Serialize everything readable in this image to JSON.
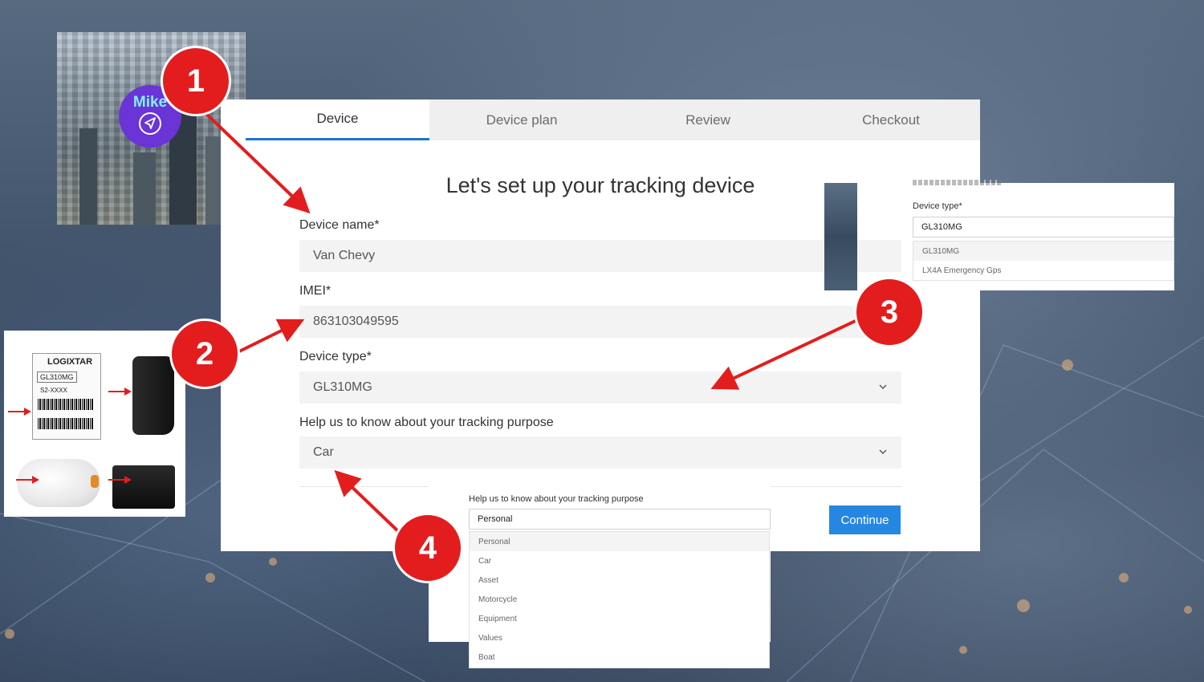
{
  "tabs": [
    {
      "label": "Device",
      "active": true
    },
    {
      "label": "Device plan",
      "active": false
    },
    {
      "label": "Review",
      "active": false
    },
    {
      "label": "Checkout",
      "active": false
    }
  ],
  "form": {
    "heading": "Let's set up your tracking device",
    "device_name_label": "Device name*",
    "device_name_value": "Van Chevy",
    "imei_label": "IMEI*",
    "imei_value": "863103049595",
    "device_type_label": "Device type*",
    "device_type_value": "GL310MG",
    "purpose_label": "Help us to know about your tracking purpose",
    "purpose_value": "Car",
    "continue_label": "Continue"
  },
  "logo": {
    "name": "Mike"
  },
  "device_type_dropdown": {
    "label": "Device type*",
    "value": "GL310MG",
    "options": [
      "GL310MG",
      "LX4A Emergency Gps"
    ]
  },
  "purpose_dropdown": {
    "label": "Help us to know about your tracking purpose",
    "value": "Personal",
    "options": [
      "Personal",
      "Car",
      "Asset",
      "Motorcycle",
      "Equipment",
      "Values",
      "Boat"
    ]
  },
  "device_label": {
    "brand": "LOGIXTAR",
    "model": "GL310MG",
    "serial": "S2-XXXX"
  },
  "badges": [
    "1",
    "2",
    "3",
    "4"
  ],
  "colors": {
    "accent": "#1e73d2",
    "continue_button": "#2587e2",
    "badge": "#e31d1d"
  }
}
